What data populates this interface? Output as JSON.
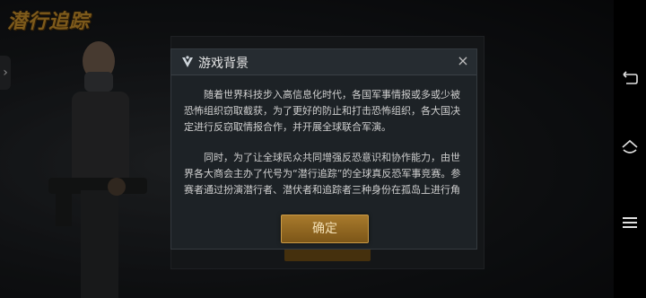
{
  "game": {
    "logo_text": "潜行追踪"
  },
  "dialog": {
    "title": "游戏背景",
    "close_symbol": "×",
    "paragraphs": [
      "随着世界科技步入高信息化时代，各国军事情报或多或少被恐怖组织窃取截获，为了更好的防止和打击恐怖组织，各大国决定进行反窃取情报合作，并开展全球联合军演。",
      "同时，为了让全球民众共同增强反恐意识和协作能力，由世界各大商会主办了代号为“潜行追踪”的全球真反恐军事竞赛。参赛者通过扮演潜行者、潜伏者和追踪者三种身份在孤岛上进行角"
    ],
    "confirm_label": "确定"
  },
  "side_tab": {
    "symbol": "›"
  },
  "nav": {
    "buttons": [
      "back",
      "home",
      "menu"
    ]
  },
  "icons": {
    "dialog_icon": "emblem-icon",
    "close": "close-icon",
    "back": "back-icon",
    "home": "home-icon",
    "menu": "menu-icon"
  },
  "colors": {
    "accent_gold": "#a87a2c",
    "dialog_bg": "#1d2226",
    "navbar": "#000000"
  }
}
